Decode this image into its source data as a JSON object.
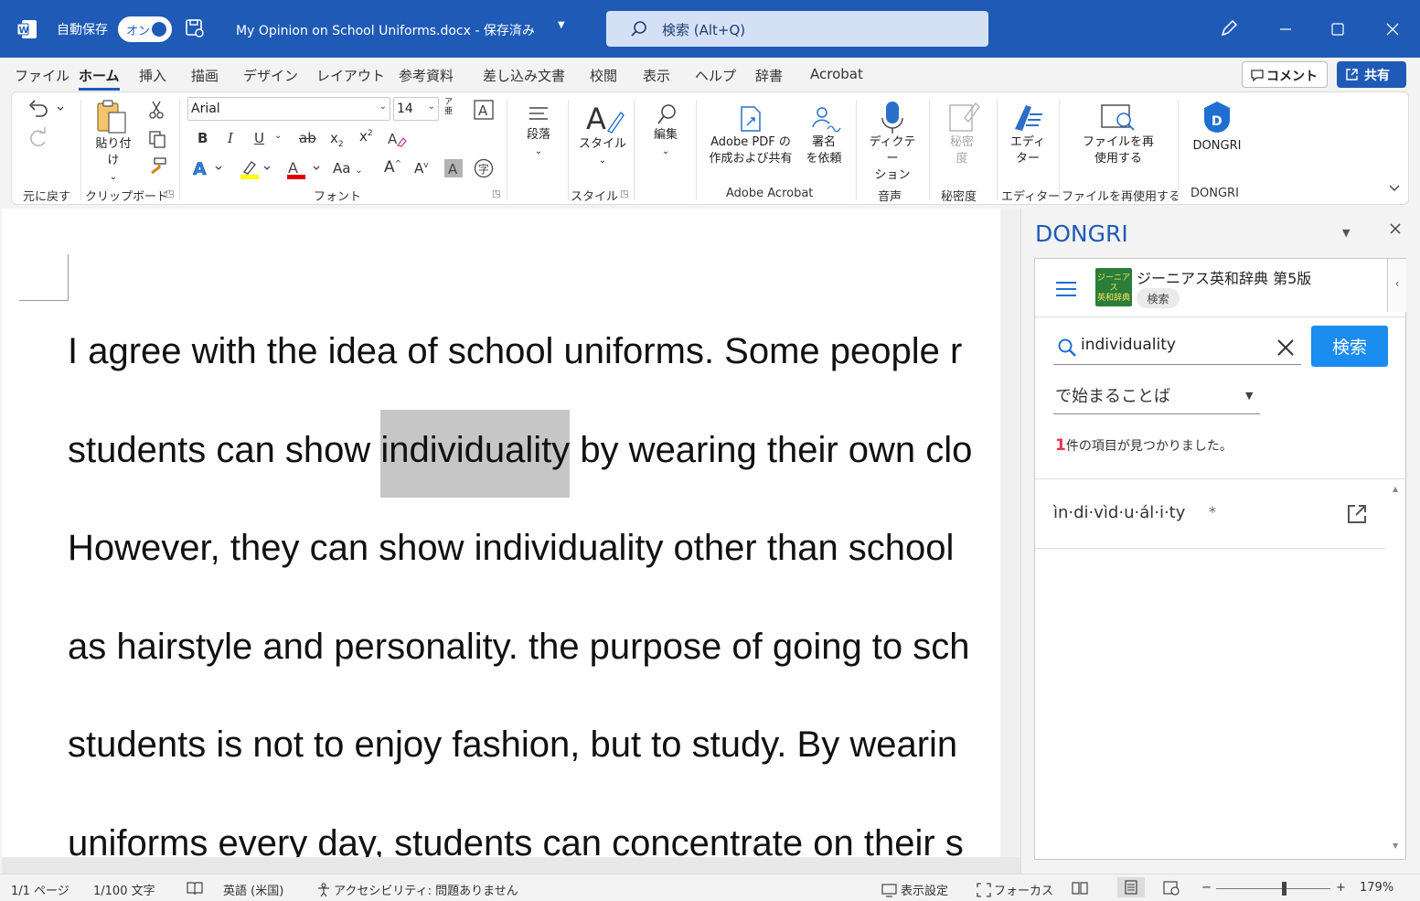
{
  "titlebar": {
    "autosave_label": "自動保存",
    "autosave_state": "オン",
    "doc_title": "My Opinion on School Uniforms.docx - 保存済み",
    "search_placeholder": "検索 (Alt+Q)"
  },
  "menu": {
    "tabs": [
      "ファイル",
      "ホーム",
      "挿入",
      "描画",
      "デザイン",
      "レイアウト",
      "参考資料",
      "差し込み文書",
      "校閲",
      "表示",
      "ヘルプ",
      "辞書",
      "Acrobat"
    ],
    "active_tab": "ホーム",
    "comment_label": "コメント",
    "share_label": "共有"
  },
  "ribbon": {
    "groups": {
      "undo": "元に戻す",
      "clipboard": "クリップボード",
      "font": "フォント",
      "style": "スタイル",
      "acrobat": "Adobe Acrobat",
      "voice": "音声",
      "sensitivity": "秘密度",
      "editor": "エディター",
      "reuse": "ファイルを再使用する",
      "dongri": "DONGRI"
    },
    "paste_label": "貼り付け",
    "font_name": "Arial",
    "font_size": "14",
    "paragraph_label": "段落",
    "styles_label": "スタイル",
    "edit_label": "編集",
    "acrobat_pdf_line1": "Adobe PDF の",
    "acrobat_pdf_line2": "作成および共有",
    "sign_line1": "署名",
    "sign_line2": "を依頼",
    "dictate_line1": "ディクテー",
    "dictate_line2": "ション",
    "sensitivity_line1": "秘密",
    "sensitivity_line2": "度",
    "editor_line1": "エディ",
    "editor_line2": "ター",
    "reuse_line1": "ファイルを再",
    "reuse_line2": "使用する",
    "dongri_label": "DONGRI",
    "font_buttons": {
      "bold": "B",
      "italic": "I",
      "underline": "U",
      "strike": "ab",
      "subscript": "x",
      "superscript": "x",
      "case": "Aa",
      "grow": "A",
      "shrink": "A",
      "highlight_color": "#ffff00",
      "font_color": "#e00000"
    }
  },
  "document": {
    "lines": [
      "I agree with the idea of school uniforms. Some people r",
      "students can show ",
      "individuality",
      " by wearing their own clo",
      "However, they can show individuality other than school",
      "as hairstyle and personality. the purpose of going to sch",
      "students is not to enjoy fashion, but to study. By wearin",
      "uniforms every day, students can concentrate on their s"
    ]
  },
  "pane": {
    "title": "DONGRI",
    "dict_cover_line1": "ジーニアス",
    "dict_cover_line2": "英和辞典",
    "dictionary_name": "ジーニアス英和辞典 第5版",
    "dictionary_chip": "検索",
    "search_value": "individuality",
    "search_button": "検索",
    "mode": "で始まることば",
    "result_count": "1",
    "result_suffix": "件の項目が見つかりました。",
    "entry_word": "ìn·di·vìd·u·ál·i·ty",
    "entry_mark": "*"
  },
  "statusbar": {
    "page": "1/1 ページ",
    "words": "1/100 文字",
    "language": "英語 (米国)",
    "accessibility": "アクセシビリティ: 問題ありません",
    "display_settings": "表示設定",
    "focus": "フォーカス",
    "zoom": "179%",
    "zoom_minus": "−",
    "zoom_plus": "+"
  }
}
